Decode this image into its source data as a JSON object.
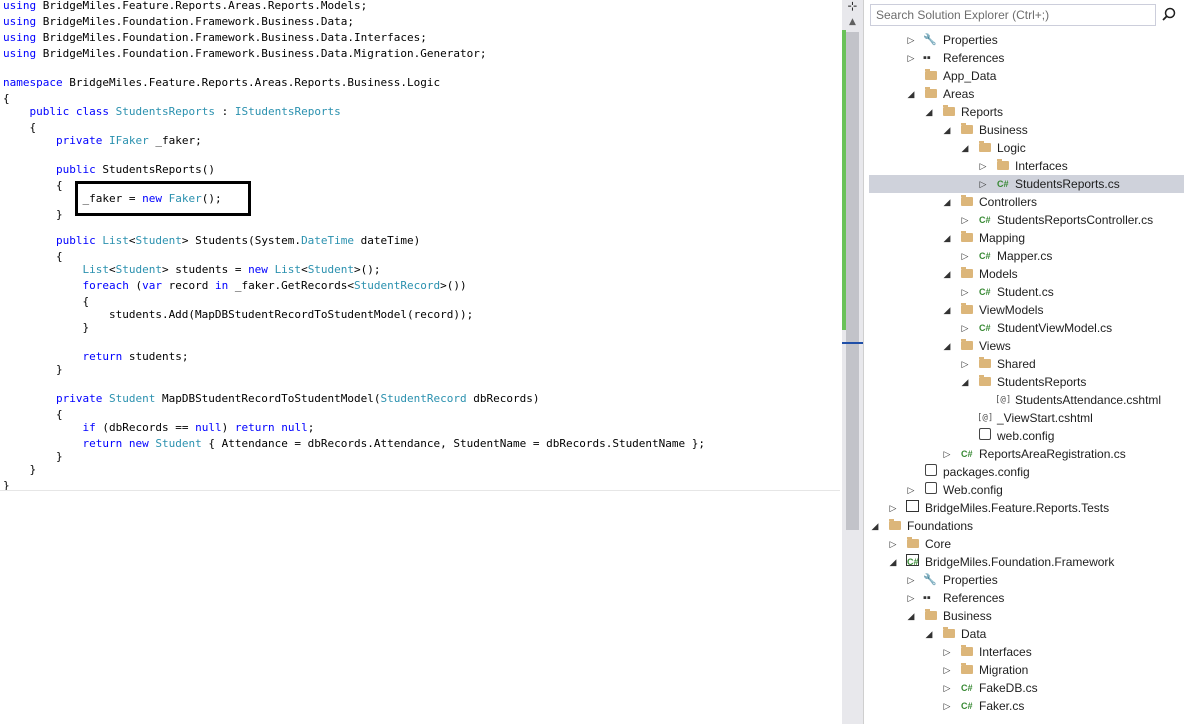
{
  "editor": {
    "lines": [
      [
        {
          "t": "using",
          "c": "kw"
        },
        {
          "t": " BridgeMiles.Feature.Reports.Areas.Reports.Models;"
        }
      ],
      [
        {
          "t": "using",
          "c": "kw"
        },
        {
          "t": " BridgeMiles.Foundation.Framework.Business.Data;"
        }
      ],
      [
        {
          "t": "using",
          "c": "kw"
        },
        {
          "t": " BridgeMiles.Foundation.Framework.Business.Data.Interfaces;"
        }
      ],
      [
        {
          "t": "using",
          "c": "kw"
        },
        {
          "t": " BridgeMiles.Foundation.Framework.Business.Data.Migration.Generator;"
        }
      ],
      [],
      [
        {
          "t": "namespace",
          "c": "kw"
        },
        {
          "t": " BridgeMiles.Feature.Reports.Areas.Reports.Business.Logic"
        }
      ],
      [
        {
          "t": "{"
        }
      ],
      [
        {
          "t": "    "
        },
        {
          "t": "public",
          "c": "kw"
        },
        {
          "t": " "
        },
        {
          "t": "class",
          "c": "kw"
        },
        {
          "t": " "
        },
        {
          "t": "StudentsReports",
          "c": "ty"
        },
        {
          "t": " : "
        },
        {
          "t": "IStudentsReports",
          "c": "ty"
        }
      ],
      [
        {
          "t": "    {"
        }
      ],
      [
        {
          "t": "        "
        },
        {
          "t": "private",
          "c": "kw"
        },
        {
          "t": " "
        },
        {
          "t": "IFaker",
          "c": "ty"
        },
        {
          "t": " _faker;"
        }
      ],
      [],
      [
        {
          "t": "        "
        },
        {
          "t": "public",
          "c": "kw"
        },
        {
          "t": " StudentsReports()"
        }
      ],
      [
        {
          "t": "        {"
        }
      ],
      [
        {
          "t": "            _faker = "
        },
        {
          "t": "new",
          "c": "kw"
        },
        {
          "t": " "
        },
        {
          "t": "Faker",
          "c": "ty"
        },
        {
          "t": "();"
        }
      ],
      [
        {
          "t": "        }"
        }
      ],
      [],
      [
        {
          "t": "        "
        },
        {
          "t": "public",
          "c": "kw"
        },
        {
          "t": " "
        },
        {
          "t": "List",
          "c": "ty"
        },
        {
          "t": "<"
        },
        {
          "t": "Student",
          "c": "ty"
        },
        {
          "t": "> Students(System."
        },
        {
          "t": "DateTime",
          "c": "ty"
        },
        {
          "t": " dateTime)"
        }
      ],
      [
        {
          "t": "        {"
        }
      ],
      [
        {
          "t": "            "
        },
        {
          "t": "List",
          "c": "ty"
        },
        {
          "t": "<"
        },
        {
          "t": "Student",
          "c": "ty"
        },
        {
          "t": "> students = "
        },
        {
          "t": "new",
          "c": "kw"
        },
        {
          "t": " "
        },
        {
          "t": "List",
          "c": "ty"
        },
        {
          "t": "<"
        },
        {
          "t": "Student",
          "c": "ty"
        },
        {
          "t": ">();"
        }
      ],
      [
        {
          "t": "            "
        },
        {
          "t": "foreach",
          "c": "kw"
        },
        {
          "t": " ("
        },
        {
          "t": "var",
          "c": "kw"
        },
        {
          "t": " record "
        },
        {
          "t": "in",
          "c": "kw"
        },
        {
          "t": " _faker.GetRecords<"
        },
        {
          "t": "StudentRecord",
          "c": "ty"
        },
        {
          "t": ">())"
        }
      ],
      [
        {
          "t": "            {"
        }
      ],
      [
        {
          "t": "                students.Add(MapDBStudentRecordToStudentModel(record));"
        }
      ],
      [
        {
          "t": "            }"
        }
      ],
      [],
      [
        {
          "t": "            "
        },
        {
          "t": "return",
          "c": "kw"
        },
        {
          "t": " students;"
        }
      ],
      [
        {
          "t": "        }"
        }
      ],
      [],
      [
        {
          "t": "        "
        },
        {
          "t": "private",
          "c": "kw"
        },
        {
          "t": " "
        },
        {
          "t": "Student",
          "c": "ty"
        },
        {
          "t": " MapDBStudentRecordToStudentModel("
        },
        {
          "t": "StudentRecord",
          "c": "ty"
        },
        {
          "t": " dbRecords)"
        }
      ],
      [
        {
          "t": "        {"
        }
      ],
      [
        {
          "t": "            "
        },
        {
          "t": "if",
          "c": "kw"
        },
        {
          "t": " (dbRecords == "
        },
        {
          "t": "null",
          "c": "kw"
        },
        {
          "t": ") "
        },
        {
          "t": "return",
          "c": "kw"
        },
        {
          "t": " "
        },
        {
          "t": "null",
          "c": "kw"
        },
        {
          "t": ";"
        }
      ],
      [
        {
          "t": "            "
        },
        {
          "t": "return",
          "c": "kw"
        },
        {
          "t": " "
        },
        {
          "t": "new",
          "c": "kw"
        },
        {
          "t": " "
        },
        {
          "t": "Student",
          "c": "ty"
        },
        {
          "t": " { Attendance = dbRecords.Attendance, StudentName = dbRecords.StudentName };"
        }
      ],
      [
        {
          "t": "        }"
        }
      ],
      [
        {
          "t": "    }"
        }
      ],
      [
        {
          "t": "}"
        }
      ]
    ]
  },
  "colors": {
    "keyword": "#0000ff",
    "type": "#2b91af",
    "selection": "#cfd2db",
    "change_bar": "#6ac259"
  },
  "solution_explorer": {
    "search_placeholder": "Search Solution Explorer (Ctrl+;)",
    "items": [
      {
        "label": "Properties",
        "icon": "wrench-icon",
        "depth": 3,
        "state": "collapsed"
      },
      {
        "label": "References",
        "icon": "references-icon",
        "depth": 3,
        "state": "collapsed"
      },
      {
        "label": "App_Data",
        "icon": "folder-icon",
        "depth": 3,
        "state": "none"
      },
      {
        "label": "Areas",
        "icon": "folder-icon",
        "depth": 3,
        "state": "expanded"
      },
      {
        "label": "Reports",
        "icon": "folder-icon",
        "depth": 4,
        "state": "expanded"
      },
      {
        "label": "Business",
        "icon": "folder-icon",
        "depth": 5,
        "state": "expanded"
      },
      {
        "label": "Logic",
        "icon": "folder-icon",
        "depth": 6,
        "state": "expanded"
      },
      {
        "label": "Interfaces",
        "icon": "folder-icon",
        "depth": 7,
        "state": "collapsed"
      },
      {
        "label": "StudentsReports.cs",
        "icon": "csharp-file-icon",
        "depth": 7,
        "state": "collapsed",
        "selected": true
      },
      {
        "label": "Controllers",
        "icon": "folder-icon",
        "depth": 5,
        "state": "expanded"
      },
      {
        "label": "StudentsReportsController.cs",
        "icon": "csharp-file-icon",
        "depth": 6,
        "state": "collapsed"
      },
      {
        "label": "Mapping",
        "icon": "folder-icon",
        "depth": 5,
        "state": "expanded"
      },
      {
        "label": "Mapper.cs",
        "icon": "csharp-file-icon",
        "depth": 6,
        "state": "collapsed"
      },
      {
        "label": "Models",
        "icon": "folder-icon",
        "depth": 5,
        "state": "expanded"
      },
      {
        "label": "Student.cs",
        "icon": "csharp-file-icon",
        "depth": 6,
        "state": "collapsed"
      },
      {
        "label": "ViewModels",
        "icon": "folder-icon",
        "depth": 5,
        "state": "expanded"
      },
      {
        "label": "StudentViewModel.cs",
        "icon": "csharp-file-icon",
        "depth": 6,
        "state": "collapsed"
      },
      {
        "label": "Views",
        "icon": "folder-icon",
        "depth": 5,
        "state": "expanded"
      },
      {
        "label": "Shared",
        "icon": "folder-icon",
        "depth": 6,
        "state": "collapsed"
      },
      {
        "label": "StudentsReports",
        "icon": "folder-icon",
        "depth": 6,
        "state": "expanded"
      },
      {
        "label": "StudentsAttendance.cshtml",
        "icon": "cshtml-file-icon",
        "depth": 7,
        "state": "none"
      },
      {
        "label": "_ViewStart.cshtml",
        "icon": "cshtml-file-icon",
        "depth": 6,
        "state": "none"
      },
      {
        "label": "web.config",
        "icon": "config-file-icon",
        "depth": 6,
        "state": "none"
      },
      {
        "label": "ReportsAreaRegistration.cs",
        "icon": "csharp-file-icon",
        "depth": 5,
        "state": "collapsed"
      },
      {
        "label": "packages.config",
        "icon": "config-file-icon",
        "depth": 3,
        "state": "none"
      },
      {
        "label": "Web.config",
        "icon": "config-file-icon",
        "depth": 3,
        "state": "collapsed"
      },
      {
        "label": "BridgeMiles.Feature.Reports.Tests",
        "icon": "test-project-icon",
        "depth": 2,
        "state": "collapsed"
      },
      {
        "label": "Foundations",
        "icon": "folder-icon",
        "depth": 1,
        "state": "expanded"
      },
      {
        "label": "Core",
        "icon": "folder-icon",
        "depth": 2,
        "state": "collapsed"
      },
      {
        "label": "BridgeMiles.Foundation.Framework",
        "icon": "csharp-project-icon",
        "depth": 2,
        "state": "expanded"
      },
      {
        "label": "Properties",
        "icon": "wrench-icon",
        "depth": 3,
        "state": "collapsed"
      },
      {
        "label": "References",
        "icon": "references-icon",
        "depth": 3,
        "state": "collapsed"
      },
      {
        "label": "Business",
        "icon": "folder-icon",
        "depth": 3,
        "state": "expanded"
      },
      {
        "label": "Data",
        "icon": "folder-icon",
        "depth": 4,
        "state": "expanded"
      },
      {
        "label": "Interfaces",
        "icon": "folder-icon",
        "depth": 5,
        "state": "collapsed"
      },
      {
        "label": "Migration",
        "icon": "folder-icon",
        "depth": 5,
        "state": "collapsed"
      },
      {
        "label": "FakeDB.cs",
        "icon": "csharp-file-icon",
        "depth": 5,
        "state": "collapsed"
      },
      {
        "label": "Faker.cs",
        "icon": "csharp-file-icon",
        "depth": 5,
        "state": "collapsed"
      }
    ]
  }
}
